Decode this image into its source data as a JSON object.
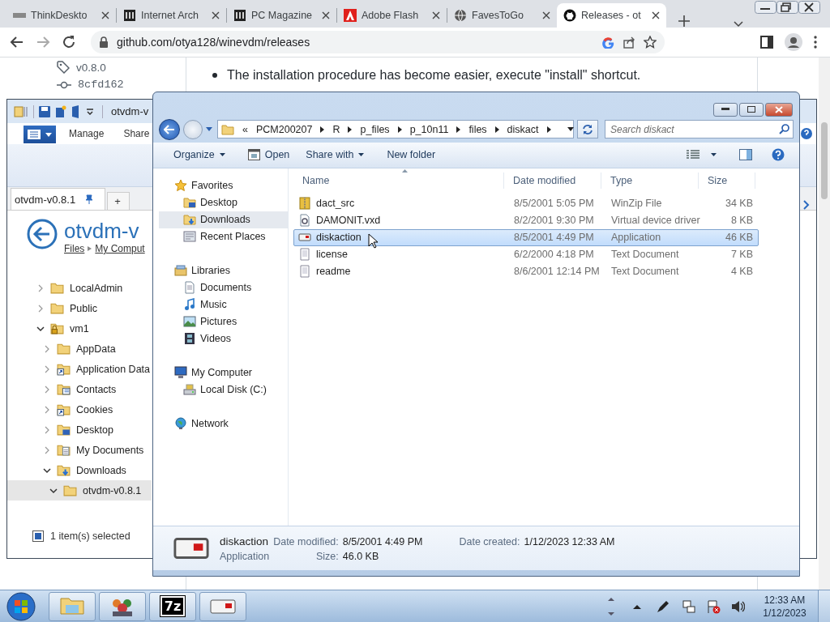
{
  "browser": {
    "tabs": [
      {
        "label": "ThinkDeskto",
        "kind": "mark",
        "selected": false
      },
      {
        "label": "Internet Arch",
        "kind": "pillars",
        "selected": false
      },
      {
        "label": "PC Magazine",
        "kind": "pillars",
        "selected": false
      },
      {
        "label": "Adobe Flash",
        "kind": "flash",
        "selected": false
      },
      {
        "label": "FavesToGo",
        "kind": "globe",
        "selected": false
      },
      {
        "label": "Releases - ot",
        "kind": "cat",
        "selected": true
      }
    ],
    "address": "github.com/otya128/winevdm/releases",
    "page": {
      "tag": "v0.8.0",
      "commit": "8cfd162",
      "bullet": "The installation procedure has become easier, execute \"install\" shortcut."
    }
  },
  "back_window": {
    "title": "otvdm-v",
    "ribbon_tabs": [
      "Manage",
      "Share"
    ],
    "tab": "otvdm-v0.8.1",
    "new_tab": "+",
    "heading": "otvdm-v",
    "breadcrumb": [
      "Files",
      "My Comput"
    ],
    "tree": [
      {
        "label": "LocalAdmin",
        "kind": "folder",
        "expanded": false,
        "selected": false
      },
      {
        "label": "Public",
        "kind": "folder",
        "expanded": false,
        "selected": false
      },
      {
        "label": "vm1",
        "kind": "user",
        "expanded": true,
        "selected": false,
        "children": [
          {
            "label": "AppData",
            "kind": "folder",
            "expanded": false,
            "selected": false
          },
          {
            "label": "Application Data",
            "kind": "shortcut",
            "expanded": false,
            "selected": false
          },
          {
            "label": "Contacts",
            "kind": "contacts",
            "expanded": false,
            "selected": false
          },
          {
            "label": "Cookies",
            "kind": "shortcut",
            "expanded": false,
            "selected": false
          },
          {
            "label": "Desktop",
            "kind": "desktop",
            "expanded": false,
            "selected": false
          },
          {
            "label": "My Documents",
            "kind": "documents",
            "expanded": false,
            "selected": false
          },
          {
            "label": "Downloads",
            "kind": "downloads",
            "expanded": true,
            "selected": false,
            "children": [
              {
                "label": "otvdm-v0.8.1",
                "kind": "folder",
                "expanded": true,
                "selected": true
              }
            ]
          }
        ]
      }
    ],
    "status": "1 item(s) selected"
  },
  "front_window": {
    "overflow": "«",
    "path": [
      "PCM200207",
      "R",
      "p_files",
      "p_10n11",
      "files",
      "diskact"
    ],
    "search": {
      "placeholder": "Search diskact"
    },
    "toolbar": [
      {
        "label": "Organize",
        "kind": "menu"
      },
      {
        "label": "Open",
        "kind": "open"
      },
      {
        "label": "Share with",
        "kind": "menu"
      },
      {
        "label": "New folder",
        "kind": "plain"
      }
    ],
    "nav": [
      {
        "label": "Favorites",
        "kind": "star",
        "items": [
          {
            "label": "Desktop",
            "kind": "desktop",
            "selected": false
          },
          {
            "label": "Downloads",
            "kind": "downloads",
            "selected": true
          },
          {
            "label": "Recent Places",
            "kind": "recent",
            "selected": false
          }
        ]
      },
      {
        "label": "Libraries",
        "kind": "libraries",
        "items": [
          {
            "label": "Documents",
            "kind": "document",
            "selected": false
          },
          {
            "label": "Music",
            "kind": "music",
            "selected": false
          },
          {
            "label": "Pictures",
            "kind": "pictures",
            "selected": false
          },
          {
            "label": "Videos",
            "kind": "videos",
            "selected": false
          }
        ]
      },
      {
        "label": "My Computer",
        "kind": "computer",
        "items": [
          {
            "label": "Local Disk (C:)",
            "kind": "disk",
            "selected": false
          }
        ]
      },
      {
        "label": "Network",
        "kind": "network"
      }
    ],
    "columns": [
      "Name",
      "Date modified",
      "Type",
      "Size"
    ],
    "files": [
      {
        "name": "dact_src",
        "date": "8/5/2001 5:05 PM",
        "type": "WinZip File",
        "size": "34 KB",
        "kind": "archive",
        "selected": false
      },
      {
        "name": "DAMONIT.vxd",
        "date": "8/2/2001 9:30 PM",
        "type": "Virtual device driver",
        "size": "8 KB",
        "kind": "driver",
        "selected": false
      },
      {
        "name": "diskaction",
        "date": "8/5/2001 4:49 PM",
        "type": "Application",
        "size": "46 KB",
        "kind": "application",
        "selected": true
      },
      {
        "name": "license",
        "date": "6/2/2000 4:18 PM",
        "type": "Text Document",
        "size": "7 KB",
        "kind": "text",
        "selected": false
      },
      {
        "name": "readme",
        "date": "8/6/2001 12:14 PM",
        "type": "Text Document",
        "size": "4 KB",
        "kind": "text",
        "selected": false
      }
    ],
    "details": {
      "name": "diskaction",
      "type": "Application",
      "kind": "application",
      "fields": [
        {
          "label": "Date modified:",
          "value": "8/5/2001 4:49 PM"
        },
        {
          "label": "Size:",
          "value": "46.0 KB"
        },
        {
          "label": "Date created:",
          "value": "1/12/2023 12:33 AM"
        }
      ]
    }
  },
  "taskbar": {
    "apps": [
      {
        "kind": "explorer"
      },
      {
        "kind": "people"
      },
      {
        "kind": "archiver",
        "label": "7z"
      },
      {
        "kind": "application"
      }
    ],
    "time": "12:33 AM",
    "date": "1/12/2023"
  }
}
